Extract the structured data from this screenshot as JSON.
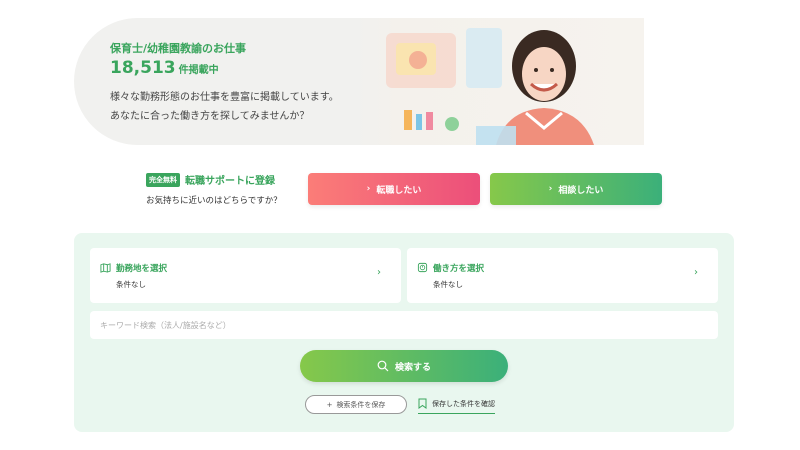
{
  "hero": {
    "title": "保育士/幼稚園教諭のお仕事",
    "count": "18,513",
    "count_suffix": "件掲載中",
    "desc_line1": "様々な勤務形態のお仕事を豊富に掲載しています。",
    "desc_line2": "あなたに合った働き方を探してみませんか？"
  },
  "support": {
    "badge": "完全無料",
    "link": "転職サポートに登録",
    "sub": "お気持ちに近いのはどちらですか？"
  },
  "cta": {
    "change_label": "転職したい",
    "consult_label": "相談したい",
    "chevron": "›"
  },
  "search": {
    "location_label": "勤務地を選択",
    "location_value": "条件なし",
    "workstyle_label": "働き方を選択",
    "workstyle_value": "条件なし",
    "keyword_placeholder": "キーワード検索（法人/施設名など）",
    "search_button": "検索する",
    "save_button": "検索条件を保存",
    "saved_link": "保存した条件を確認",
    "chevron": "›",
    "plus": "+"
  },
  "colors": {
    "accent_green": "#3aa55d",
    "panel_bg": "#e9f7ef",
    "pink_gradient_start": "#fb7d78",
    "pink_gradient_end": "#ec4f7a"
  }
}
